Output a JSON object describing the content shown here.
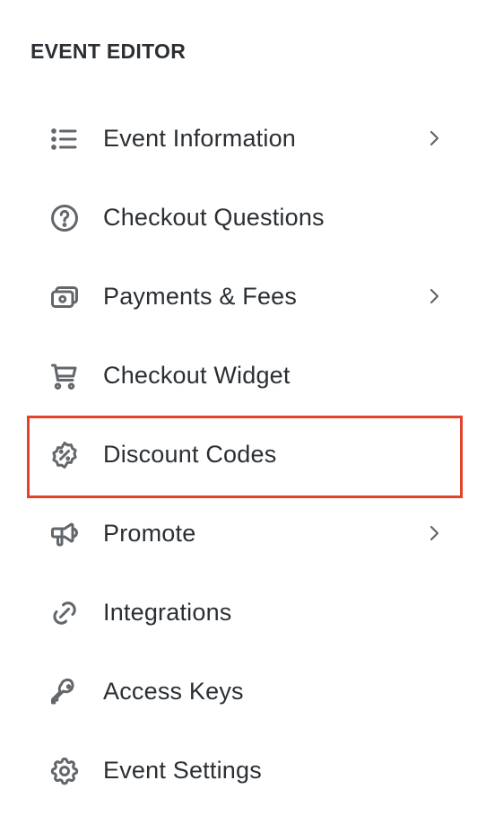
{
  "sidebar": {
    "title": "EVENT EDITOR",
    "highlight_color": "#e2432a",
    "items": [
      {
        "label": "Event Information",
        "icon": "list-icon",
        "has_chevron": true
      },
      {
        "label": "Checkout Questions",
        "icon": "question-circle-icon",
        "has_chevron": false
      },
      {
        "label": "Payments & Fees",
        "icon": "cash-icon",
        "has_chevron": true
      },
      {
        "label": "Checkout Widget",
        "icon": "shopping-cart-icon",
        "has_chevron": false
      },
      {
        "label": "Discount Codes",
        "icon": "discount-badge-icon",
        "has_chevron": false,
        "highlighted": true
      },
      {
        "label": "Promote",
        "icon": "megaphone-icon",
        "has_chevron": true
      },
      {
        "label": "Integrations",
        "icon": "link-icon",
        "has_chevron": false
      },
      {
        "label": "Access Keys",
        "icon": "key-icon",
        "has_chevron": false
      },
      {
        "label": "Event Settings",
        "icon": "gear-icon",
        "has_chevron": false
      }
    ]
  }
}
